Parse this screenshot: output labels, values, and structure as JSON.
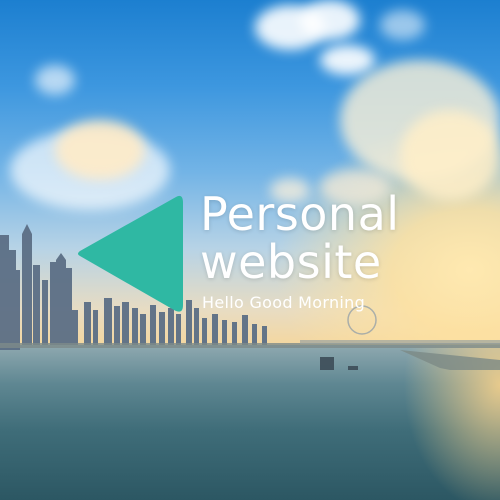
{
  "hero": {
    "title_line1": "Personal",
    "title_line2": "website",
    "subtitle": "Hello Good Morning"
  },
  "logo": {
    "icon": "play-triangle-icon",
    "color": "#2fb8a3"
  },
  "colors": {
    "text": "#ffffff",
    "sky_top": "#1c7fd0",
    "water": "#3f6d79"
  }
}
